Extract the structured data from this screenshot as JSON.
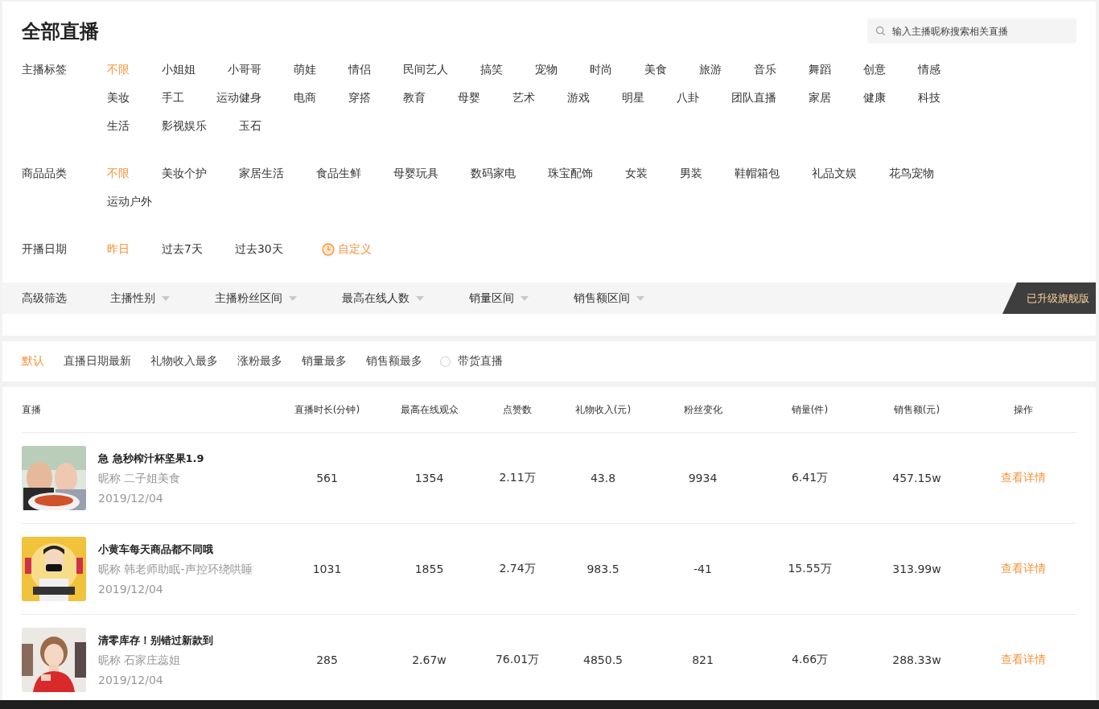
{
  "title": "全部直播",
  "search": {
    "placeholder": "输入主播昵称搜索相关直播"
  },
  "filters": [
    {
      "label": "主播标签",
      "options": [
        {
          "label": "不限",
          "selected": true
        },
        {
          "label": "小姐姐",
          "selected": false
        },
        {
          "label": "小哥哥",
          "selected": false
        },
        {
          "label": "萌娃",
          "selected": false
        },
        {
          "label": "情侣",
          "selected": false
        },
        {
          "label": "民间艺人",
          "selected": false
        },
        {
          "label": "搞笑",
          "selected": false
        },
        {
          "label": "宠物",
          "selected": false
        },
        {
          "label": "时尚",
          "selected": false
        },
        {
          "label": "美食",
          "selected": false
        },
        {
          "label": "旅游",
          "selected": false
        },
        {
          "label": "音乐",
          "selected": false
        },
        {
          "label": "舞蹈",
          "selected": false
        },
        {
          "label": "创意",
          "selected": false
        },
        {
          "label": "情感",
          "selected": false
        },
        {
          "label": "美妆",
          "selected": false
        },
        {
          "label": "手工",
          "selected": false
        },
        {
          "label": "运动健身",
          "selected": false
        },
        {
          "label": "电商",
          "selected": false
        },
        {
          "label": "穿搭",
          "selected": false
        },
        {
          "label": "教育",
          "selected": false
        },
        {
          "label": "母婴",
          "selected": false
        },
        {
          "label": "艺术",
          "selected": false
        },
        {
          "label": "游戏",
          "selected": false
        },
        {
          "label": "明星",
          "selected": false
        },
        {
          "label": "八卦",
          "selected": false
        },
        {
          "label": "团队直播",
          "selected": false
        },
        {
          "label": "家居",
          "selected": false
        },
        {
          "label": "健康",
          "selected": false
        },
        {
          "label": "科技",
          "selected": false
        },
        {
          "label": "生活",
          "selected": false
        },
        {
          "label": "影视娱乐",
          "selected": false
        },
        {
          "label": "玉石",
          "selected": false
        }
      ]
    },
    {
      "label": "商品品类",
      "options": [
        {
          "label": "不限",
          "selected": true
        },
        {
          "label": "美妆个护",
          "selected": false
        },
        {
          "label": "家居生活",
          "selected": false
        },
        {
          "label": "食品生鲜",
          "selected": false
        },
        {
          "label": "母婴玩具",
          "selected": false
        },
        {
          "label": "数码家电",
          "selected": false
        },
        {
          "label": "珠宝配饰",
          "selected": false
        },
        {
          "label": "女装",
          "selected": false
        },
        {
          "label": "男装",
          "selected": false
        },
        {
          "label": "鞋帽箱包",
          "selected": false
        },
        {
          "label": "礼品文娱",
          "selected": false
        },
        {
          "label": "花鸟宠物",
          "selected": false
        },
        {
          "label": "运动户外",
          "selected": false
        }
      ]
    },
    {
      "label": "开播日期",
      "options": [
        {
          "label": "昨日",
          "selected": true
        },
        {
          "label": "过去7天",
          "selected": false
        },
        {
          "label": "过去30天",
          "selected": false
        }
      ],
      "custom_button": "自定义"
    }
  ],
  "advanced": {
    "label": "高级筛选",
    "dropdowns": [
      "主播性别",
      "主播粉丝区间",
      "最高在线人数",
      "销量区间",
      "销售额区间"
    ],
    "badge": "已升级旗舰版"
  },
  "sort": {
    "options": [
      {
        "label": "默认",
        "selected": true
      },
      {
        "label": "直播日期最新",
        "selected": false
      },
      {
        "label": "礼物收入最多",
        "selected": false
      },
      {
        "label": "涨粉最多",
        "selected": false
      },
      {
        "label": "销量最多",
        "selected": false
      },
      {
        "label": "销售额最多",
        "selected": false
      }
    ],
    "toggle": {
      "label": "带货直播",
      "checked": false
    }
  },
  "table": {
    "columns": [
      "直播",
      "直播时长(分钟)",
      "最高在线观众",
      "点赞数",
      "礼物收入(元)",
      "粉丝变化",
      "销量(件)",
      "销售额(元)",
      "操作"
    ],
    "rows": [
      {
        "cells": [
          {
            "title": "急 急秒榨汁杯坚果1.9",
            "nickname": "昵称 二子姐美食",
            "date": "2019/12/04"
          },
          "561",
          "1354",
          "2.11万",
          "43.8",
          "9934",
          "6.41万",
          "457.15w",
          "查看详情"
        ]
      },
      {
        "cells": [
          {
            "title": "小黄车每天商品都不同哦",
            "nickname": "昵称 韩老师助眠-声控环绕哄睡",
            "date": "2019/12/04"
          },
          "1031",
          "1855",
          "2.74万",
          "983.5",
          "-41",
          "15.55万",
          "313.99w",
          "查看详情"
        ]
      },
      {
        "cells": [
          {
            "title": "清零库存！别错过新款到",
            "nickname": "昵称 石家庄蕊姐",
            "date": "2019/12/04"
          },
          "285",
          "2.67w",
          "76.01万",
          "4850.5",
          "821",
          "4.66万",
          "288.33w",
          "查看详情"
        ]
      }
    ]
  }
}
